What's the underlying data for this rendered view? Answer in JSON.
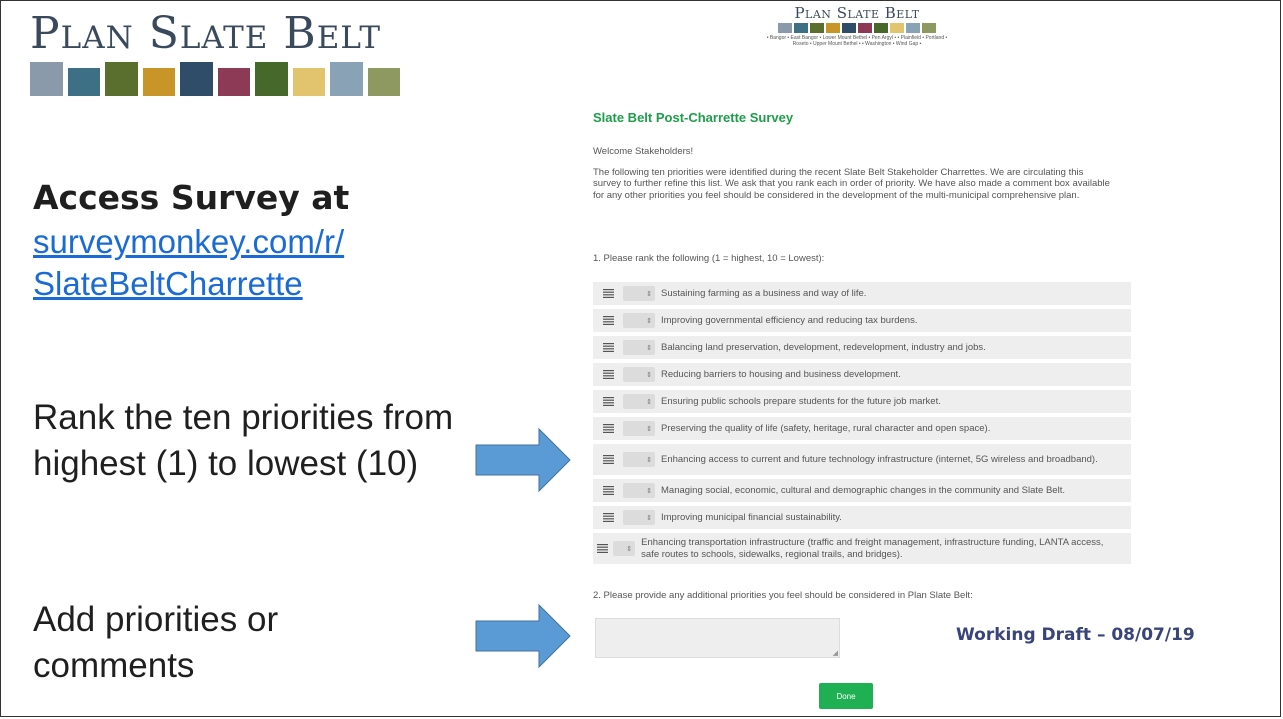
{
  "logo": {
    "title": "Plan Slate Belt",
    "bar_colors": [
      "#8a9aaa",
      "#3d6f85",
      "#5a6e2e",
      "#c89628",
      "#2f4d68",
      "#8c3a55",
      "#47682b",
      "#e2c46e",
      "#8aa2b5",
      "#8d9960"
    ]
  },
  "left": {
    "access_title": "Access Survey at",
    "access_link": "surveymonkey.com/r/ SlateBeltCharrette",
    "rank_text": "Rank the ten priorities from highest (1) to lowest (10)",
    "add_text": "Add priorities or comments"
  },
  "survey": {
    "logo_title": "Plan Slate Belt",
    "logo_towns": "• Bangor • East Bangor • Lower Mount Bethel • Pen Argyl • • Plainfield • Portland • Roseto • Upper Mount Bethel • • Washington • Wind Gap •",
    "title": "Slate Belt Post-Charrette Survey",
    "welcome": "Welcome Stakeholders!",
    "intro": "The following ten priorities were identified during the recent Slate Belt Stakeholder Charrettes. We are circulating this survey to further refine this list. We ask that you rank each in order of priority. We have also made a comment box available for any other priorities you feel should be considered in the development of the multi-municipal comprehensive plan.",
    "q1": "1. Please rank the following (1 = highest, 10 = Lowest):",
    "priorities": [
      "Sustaining farming as a business and way of life.",
      "Improving governmental efficiency and reducing tax burdens.",
      "Balancing land preservation, development, redevelopment, industry and jobs.",
      "Reducing barriers to housing and business development.",
      "Ensuring public schools prepare students for the future job market.",
      "Preserving the quality of life (safety, heritage, rural character and open space).",
      "Enhancing access to current and future technology infrastructure (internet, 5G wireless and broadband).",
      "Managing social, economic, cultural and demographic changes in the community and Slate Belt.",
      "Improving municipal financial sustainability.",
      "Enhancing transportation infrastructure (traffic and freight management, infrastructure funding, LANTA access, safe routes to schools, sidewalks, regional trails, and bridges)."
    ],
    "select_glyph": "⇕",
    "q2": "2. Please provide any additional priorities you feel should be considered in Plan Slate Belt:",
    "comment_value": "",
    "done_label": "Done"
  },
  "working_draft": "Working Draft – 08/07/19",
  "colors": {
    "arrow": "#5b9bd5",
    "survey_title": "#1e9e4a",
    "done": "#1fb053",
    "draft": "#38447a"
  }
}
